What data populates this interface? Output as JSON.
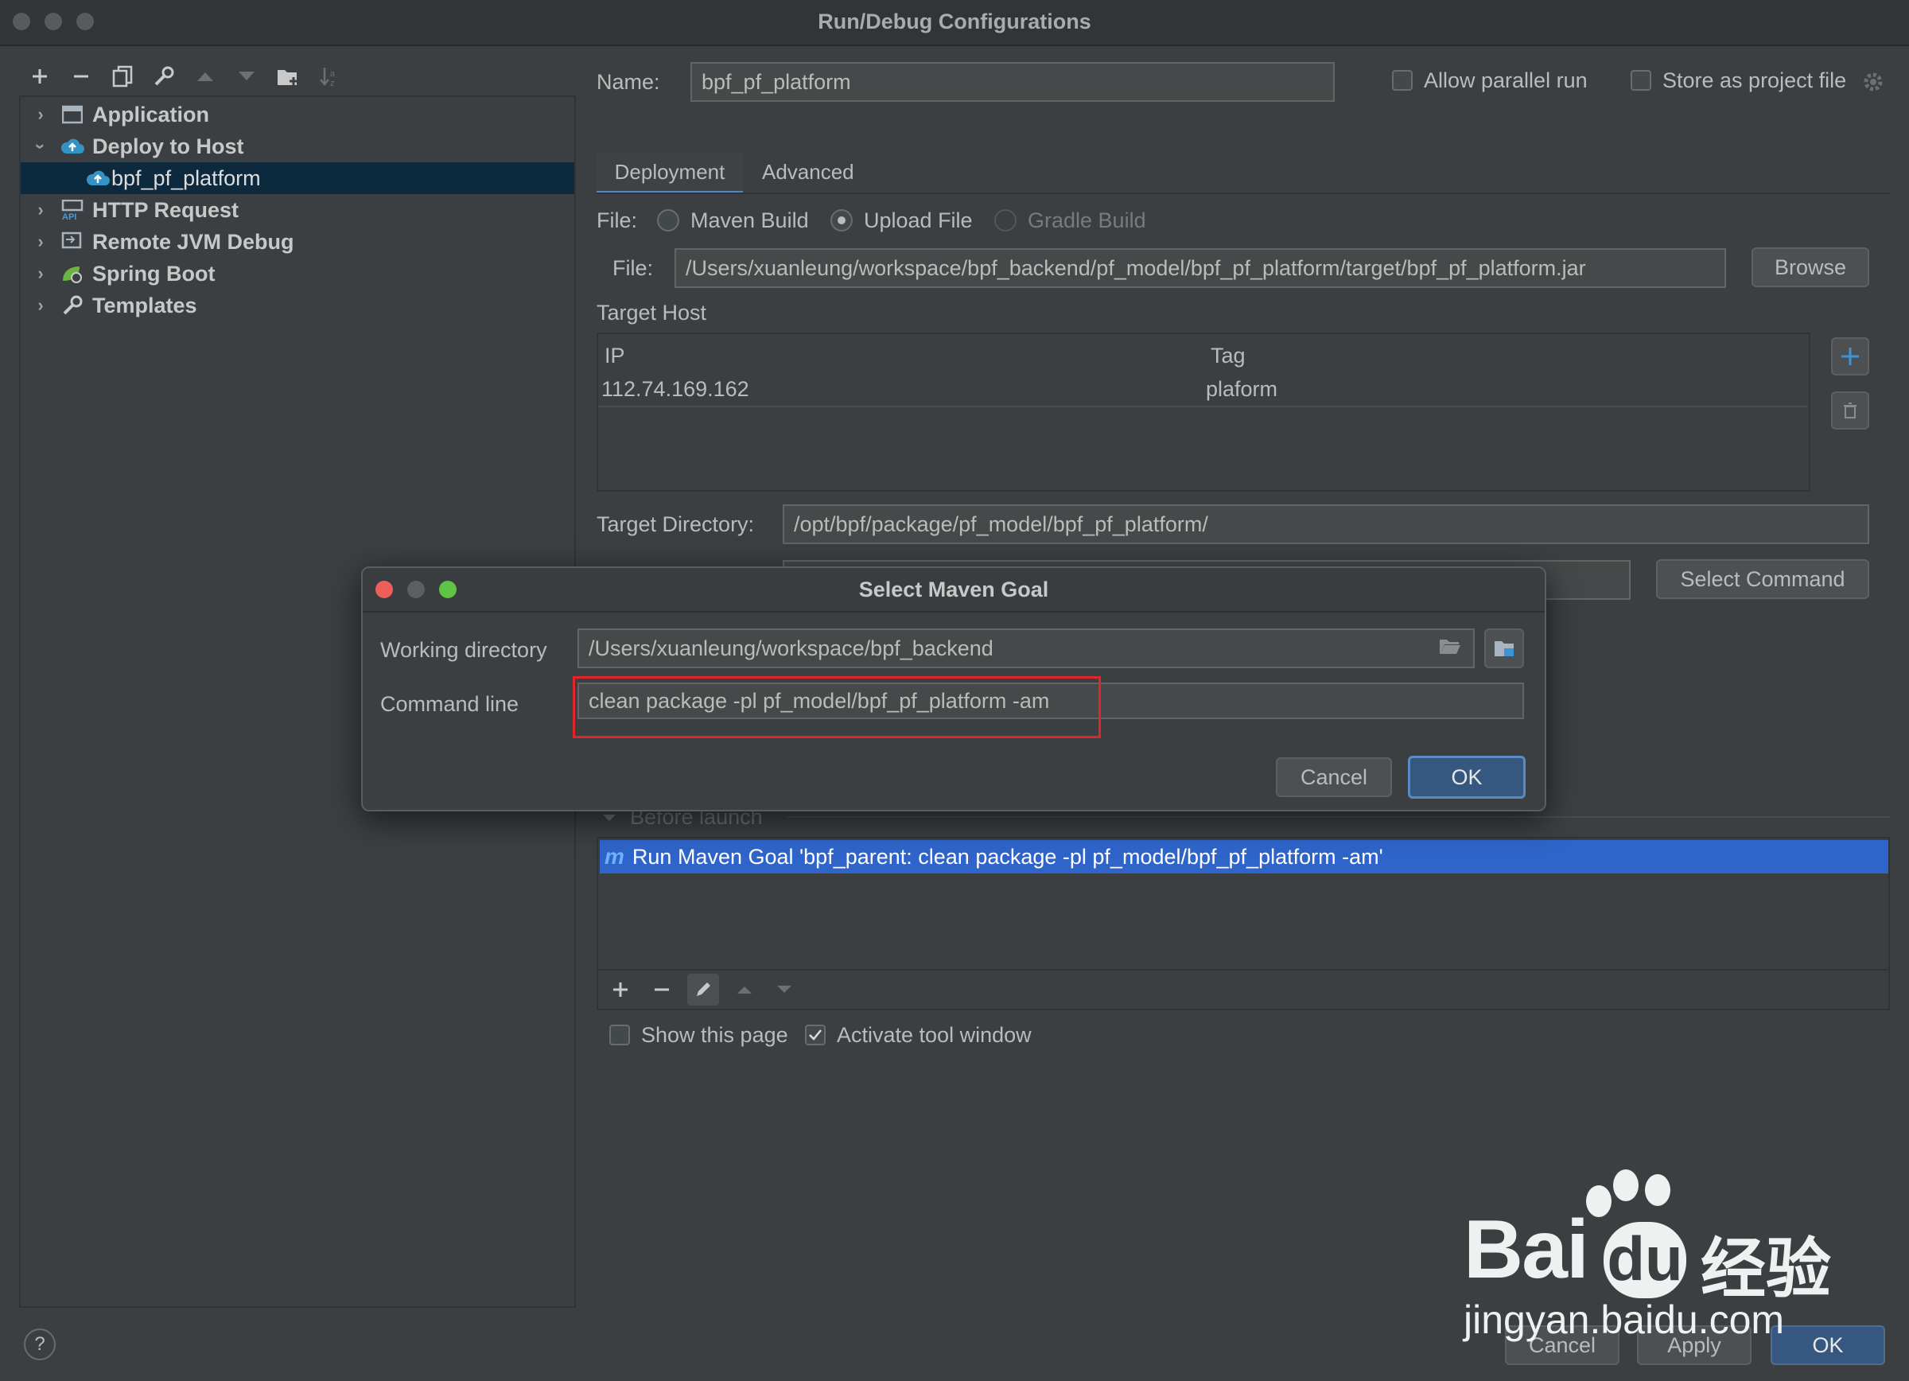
{
  "window": {
    "title": "Run/Debug Configurations"
  },
  "toolbar": {
    "icons": [
      "add-icon",
      "remove-icon",
      "copy-icon",
      "wrench-icon",
      "move-up-icon",
      "move-down-icon",
      "new-folder-icon",
      "sort-icon"
    ]
  },
  "tree": {
    "items": [
      {
        "label": "Application",
        "expanded": false
      },
      {
        "label": "Deploy to Host",
        "expanded": true
      },
      {
        "label": "bpf_pf_platform",
        "selected": true
      },
      {
        "label": "HTTP Request",
        "expanded": false
      },
      {
        "label": "Remote JVM Debug",
        "expanded": false
      },
      {
        "label": "Spring Boot",
        "expanded": false
      },
      {
        "label": "Templates",
        "expanded": false
      }
    ]
  },
  "config": {
    "name_label": "Name:",
    "name_value": "bpf_pf_platform",
    "allow_parallel_label": "Allow parallel run",
    "store_project_label": "Store as project file",
    "tabs": [
      "Deployment",
      "Advanced"
    ],
    "file_label": "File:",
    "radio_options": [
      "Maven Build",
      "Upload File",
      "Gradle Build"
    ],
    "selected_radio": "Upload File",
    "file_path_label": "File:",
    "file_path_value": "/Users/xuanleung/workspace/bpf_backend/pf_model/bpf_pf_platform/target/bpf_pf_platform.jar",
    "browse_label": "Browse",
    "target_host_label": "Target Host",
    "host_columns": [
      "IP",
      "Tag"
    ],
    "host_rows": [
      {
        "ip": "112.74.169.162",
        "tag": "plaform"
      }
    ],
    "target_dir_label": "Target Directory:",
    "target_dir_value": "/opt/bpf/package/pf_model/bpf_pf_platform/",
    "select_command_label": "Select Command"
  },
  "before_launch": {
    "label": "Before launch",
    "items": [
      "Run Maven Goal 'bpf_parent: clean package -pl pf_model/bpf_pf_platform -am'"
    ],
    "show_page_label": "Show this page",
    "activate_tool_label": "Activate tool window"
  },
  "dialog": {
    "title": "Select Maven Goal",
    "working_dir_label": "Working directory",
    "working_dir_value": "/Users/xuanleung/workspace/bpf_backend",
    "command_line_label": "Command line",
    "command_line_value": "clean package -pl pf_model/bpf_pf_platform -am",
    "cancel_label": "Cancel",
    "ok_label": "OK",
    "highlight_color": "#e0252b"
  },
  "footer": {
    "help_label": "?",
    "cancel_label": "Cancel",
    "apply_label": "Apply",
    "ok_label": "OK"
  },
  "watermark": {
    "brand": "Bai",
    "brand_du": "du",
    "brand_cn": "经验",
    "url": "jingyan.baidu.com"
  }
}
